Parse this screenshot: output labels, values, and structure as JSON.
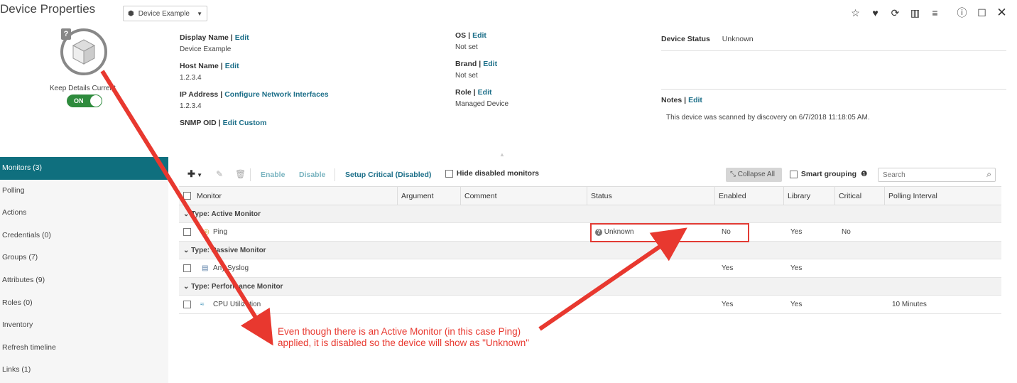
{
  "header": {
    "title": "Device Properties",
    "device_selector": "Device Example"
  },
  "device_panel": {
    "keep_details_label": "Keep Details Current",
    "toggle_label": "ON"
  },
  "fields": {
    "display_name": {
      "label": "Display Name |",
      "action": "Edit",
      "value": "Device Example"
    },
    "host_name": {
      "label": "Host Name |",
      "action": "Edit",
      "value": "1.2.3.4"
    },
    "ip_address": {
      "label": "IP Address |",
      "action": "Configure Network Interfaces",
      "value": "1.2.3.4"
    },
    "snmp_oid": {
      "label": "SNMP OID |",
      "action": "Edit Custom"
    },
    "os": {
      "label": "OS |",
      "action": "Edit",
      "value": "Not set"
    },
    "brand": {
      "label": "Brand |",
      "action": "Edit",
      "value": "Not set"
    },
    "role": {
      "label": "Role |",
      "action": "Edit",
      "value": "Managed Device"
    }
  },
  "status_panel": {
    "device_status_label": "Device Status",
    "device_status_value": "Unknown",
    "notes_label": "Notes |",
    "notes_action": "Edit",
    "notes_text": "This device was scanned by discovery on 6/7/2018 11:18:05 AM."
  },
  "sidebar": {
    "items": [
      {
        "label": "Monitors (3)",
        "active": true
      },
      {
        "label": "Polling"
      },
      {
        "label": "Actions"
      },
      {
        "label": "Credentials (0)"
      },
      {
        "label": "Groups (7)"
      },
      {
        "label": "Attributes (9)"
      },
      {
        "label": "Roles (0)"
      },
      {
        "label": "Inventory"
      },
      {
        "label": "Refresh timeline"
      },
      {
        "label": "Links (1)"
      }
    ]
  },
  "toolbar": {
    "enable": "Enable",
    "disable": "Disable",
    "setup_critical": "Setup Critical (Disabled)",
    "hide_disabled": "Hide disabled monitors",
    "collapse_all": "Collapse All",
    "smart_grouping": "Smart grouping",
    "search_placeholder": "Search"
  },
  "table": {
    "columns": [
      "Monitor",
      "Argument",
      "Comment",
      "Status",
      "Enabled",
      "Library",
      "Critical",
      "Polling Interval"
    ],
    "groups": [
      {
        "label": "Type: Active Monitor",
        "rows": [
          {
            "monitor": "Ping",
            "status": "Unknown",
            "enabled": "No",
            "library": "Yes",
            "critical": "No",
            "polling": ""
          }
        ]
      },
      {
        "label": "Type: Passive Monitor",
        "rows": [
          {
            "monitor": "Any Syslog",
            "status": "",
            "enabled": "Yes",
            "library": "Yes",
            "critical": "",
            "polling": ""
          }
        ]
      },
      {
        "label": "Type: Performance Monitor",
        "rows": [
          {
            "monitor": "CPU Utilization",
            "status": "",
            "enabled": "Yes",
            "library": "Yes",
            "critical": "",
            "polling": "10 Minutes"
          }
        ]
      }
    ]
  },
  "annotation": {
    "text": "Even though there is an Active Monitor (in this case Ping) applied, it is disabled so the device will show as \"Unknown\"",
    "color": "#e8382f"
  },
  "colors": {
    "accent": "#0f6f7e",
    "link": "#1b6e88",
    "toggle_on": "#2e8b3d"
  }
}
